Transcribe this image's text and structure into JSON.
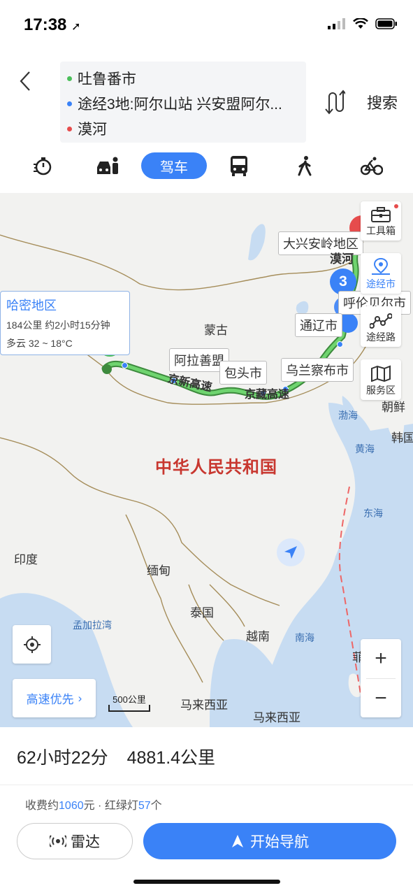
{
  "status_bar": {
    "time": "17:38"
  },
  "route": {
    "start": "吐鲁番市",
    "via": "途经3地:阿尔山站 兴安盟阿尔...",
    "end": "漠河",
    "search_label": "搜索"
  },
  "tabs": {
    "active_label": "驾车"
  },
  "map": {
    "info_card": {
      "title": "哈密地区",
      "distance_time": "184公里 约2小时15分钟",
      "weather": "多云 32 ~ 18°C"
    },
    "start_marker": "起",
    "via_marker": "3",
    "city_tags": {
      "daxinganling": "大兴安岭地区",
      "hulunbuir": "呼伦贝尔市",
      "tongliao": "通辽市",
      "alxa": "阿拉善盟",
      "baotou": "包头市",
      "ulanqab": "乌兰察布市"
    },
    "road_names": {
      "jingxin": "京新高速",
      "jingzang": "京藏高速"
    },
    "labels": {
      "mohe": "漠河",
      "mongolia": "蒙古",
      "china": "中华人民共和国",
      "korea_n": "朝鲜",
      "korea_s": "韩国",
      "india": "印度",
      "myanmar": "缅甸",
      "thailand": "泰国",
      "vietnam": "越南",
      "malaysia_1": "马来西亚",
      "malaysia_2": "马来西亚",
      "philippines": "菲"
    },
    "seas": {
      "bohai": "渤海",
      "huanghai": "黄海",
      "donghai": "东海",
      "nanhai": "南海",
      "bengal": "孟加拉湾"
    },
    "tools": {
      "toolbox": "工具箱",
      "waypoints": "途经市",
      "route": "途经路",
      "service": "服务区"
    },
    "preference": "高速优先",
    "scale": "500公里"
  },
  "summary": {
    "duration": "62小时22分",
    "distance": "4881.4公里"
  },
  "fee": {
    "prefix": "收费约",
    "toll": "1060",
    "mid": "元 · 红绿灯",
    "lights": "57",
    "suffix": "个"
  },
  "buttons": {
    "radar": "雷达",
    "navigate": "开始导航"
  },
  "colors": {
    "accent": "#3a82f7",
    "route": "#4bbf5a",
    "end": "#e64c4c"
  }
}
